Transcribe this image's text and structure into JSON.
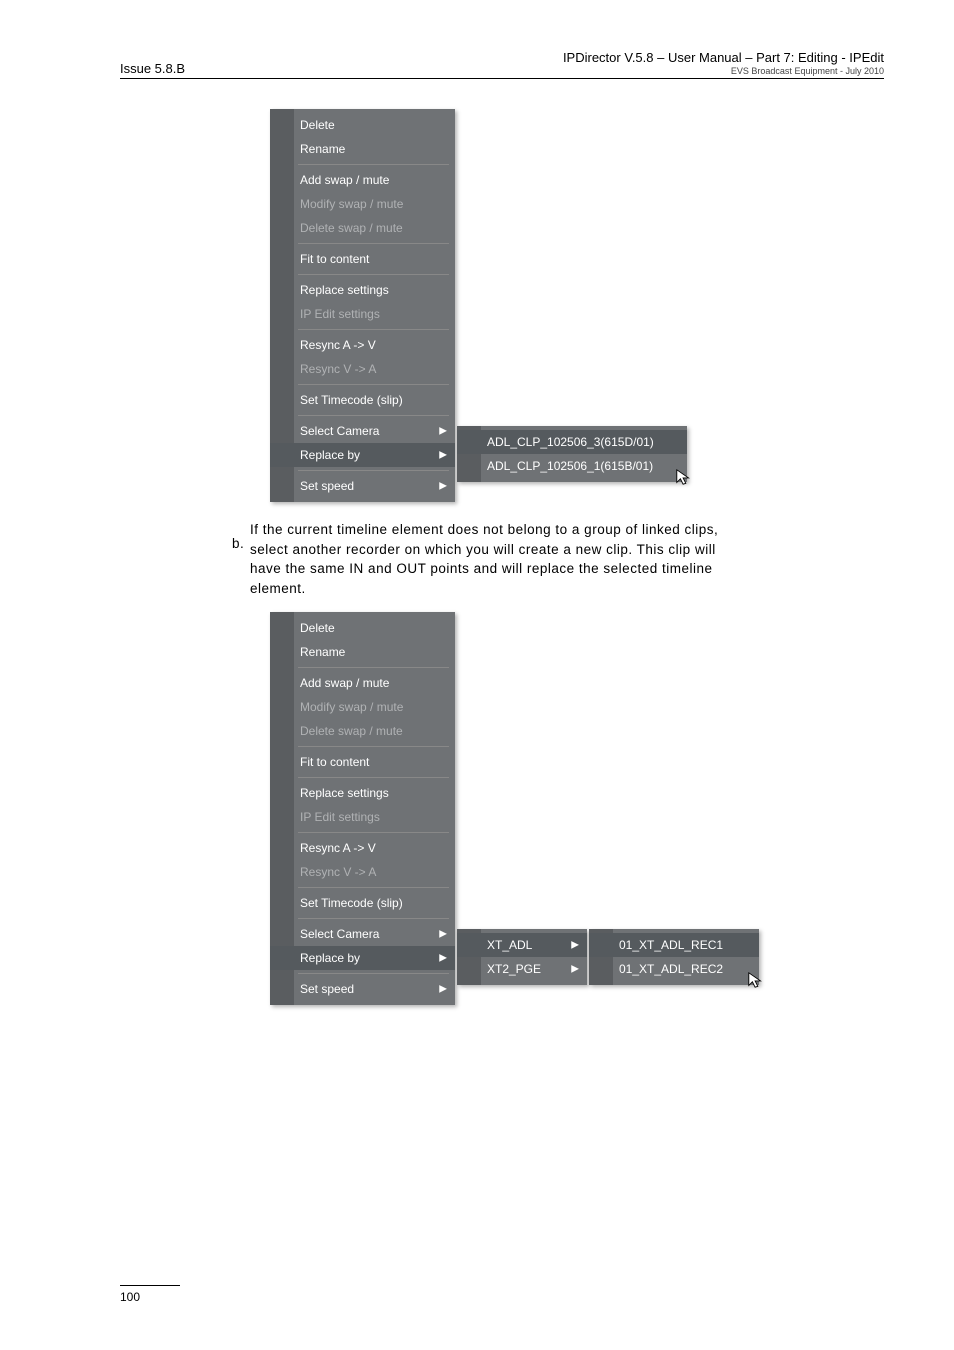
{
  "header": {
    "left": "Issue 5.8.B",
    "right_line1": "IPDirector V.5.8 – User Manual – Part 7: Editing - IPEdit",
    "right_line2": "EVS Broadcast Equipment -   July 2010"
  },
  "menu": {
    "delete": "Delete",
    "rename": "Rename",
    "add_swap": "Add swap / mute",
    "modify_swap": "Modify swap / mute",
    "delete_swap": "Delete swap / mute",
    "fit": "Fit to content",
    "replace_settings": "Replace settings",
    "ip_edit": "IP Edit settings",
    "resync_av": "Resync A -> V",
    "resync_va": "Resync V -> A",
    "set_tc": "Set Timecode (slip)",
    "select_cam": "Select Camera",
    "replace_by": "Replace by",
    "set_speed": "Set speed"
  },
  "submenu1": {
    "item_a": "ADL_CLP_102506_3(615D/01)",
    "item_b": "ADL_CLP_102506_1(615B/01)"
  },
  "paragraph": {
    "label": "b.",
    "line1": "If the current timeline element does not belong to a group of linked clips,",
    "line2": "select another recorder on which you will create a new clip. This clip will",
    "line3": "have the same IN and OUT points and will replace the selected timeline",
    "line4": "element."
  },
  "submenu2_level1": {
    "xt_adl": "XT_ADL",
    "xt2_pge": "XT2_PGE"
  },
  "submenu2_level2": {
    "rec1": "01_XT_ADL_REC1",
    "rec2": "01_XT_ADL_REC2"
  },
  "footer": {
    "page": "100"
  },
  "icons": {
    "arrow": "▶"
  }
}
